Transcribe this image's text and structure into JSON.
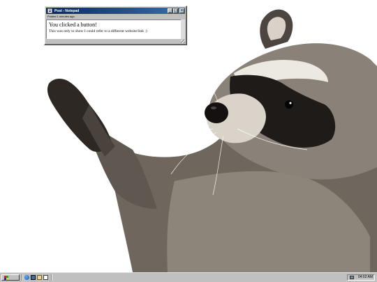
{
  "window": {
    "title": "Post - Notepad",
    "subtitle": "Posted 1 minutes ago",
    "lines": [
      "You clicked a button!",
      "This was only to show I could refer to a different website/link :)"
    ],
    "controls": {
      "minimize": "_",
      "maximize": "□",
      "close": "×"
    }
  },
  "taskbar": {
    "start_icon": "windows-flag-icon",
    "quick_launch": [
      "internet-explorer-icon",
      "show-desktop-icon",
      "outlook-express-icon",
      "channels-icon"
    ],
    "tray_icon": "network-monitor-icon",
    "clock": "04:02 AM"
  },
  "desktop": {
    "wallpaper": "raccoon-icon"
  },
  "colors": {
    "titlebar": "#0a246a",
    "face": "#c0c0c0",
    "desktop": "#ffffff"
  }
}
